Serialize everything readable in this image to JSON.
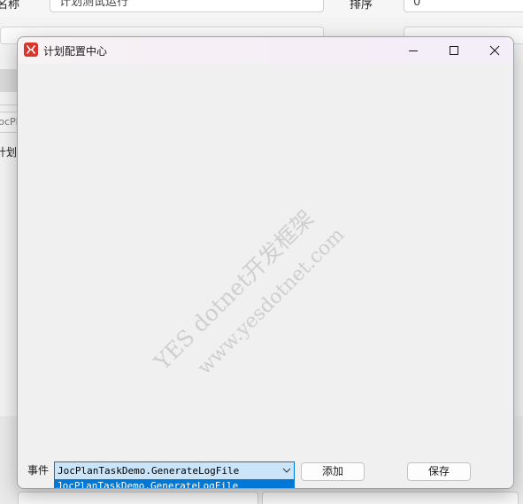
{
  "background_window": {
    "field1_label": "名称",
    "field1_value": "计划测试运行",
    "field2_label": "排序",
    "field2_value": "0",
    "tab_label": "JocPla",
    "cell_text": "计划"
  },
  "dialog": {
    "title": "计划配置中心",
    "watermark_line1": "YES dotnet开发框架",
    "watermark_line2": "www.yesdotnet.com",
    "event_label": "事件",
    "event_select_value": "JocPlanTaskDemo.GenerateLogFile",
    "event_options": [
      "JocPlanTaskDemo.GenerateLogFile"
    ],
    "add_button": "添加",
    "save_button": "保存"
  },
  "colors": {
    "accent": "#0078d7",
    "app_icon": "#d9352b"
  }
}
